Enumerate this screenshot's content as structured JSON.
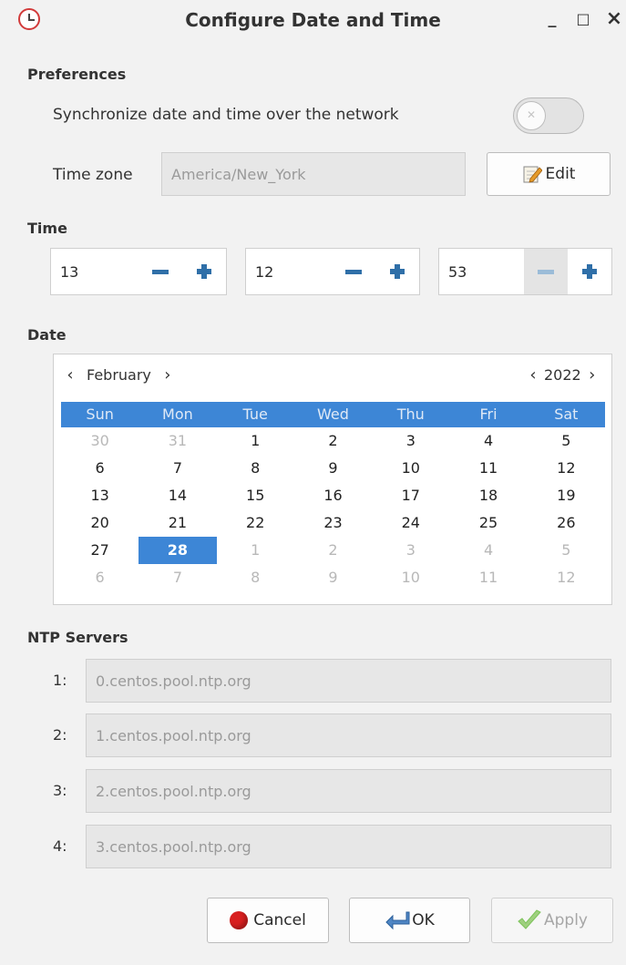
{
  "window": {
    "title": "Configure Date and Time",
    "controls": {
      "minimize": "_",
      "maximize": "□",
      "close": "×"
    }
  },
  "preferences": {
    "heading": "Preferences",
    "sync_label": "Synchronize date and time over the network",
    "sync_enabled": false,
    "timezone_label": "Time zone",
    "timezone_value": "America/New_York",
    "edit_label": "Edit"
  },
  "time": {
    "heading": "Time",
    "hours": "13",
    "minutes": "12",
    "seconds": "53"
  },
  "date": {
    "heading": "Date",
    "month": "February",
    "year": "2022",
    "prev_symbol": "‹",
    "next_symbol": "›",
    "weekdays": [
      "Sun",
      "Mon",
      "Tue",
      "Wed",
      "Thu",
      "Fri",
      "Sat"
    ],
    "days": [
      [
        "30",
        "31",
        "1",
        "2",
        "3",
        "4",
        "5"
      ],
      [
        "6",
        "7",
        "8",
        "9",
        "10",
        "11",
        "12"
      ],
      [
        "13",
        "14",
        "15",
        "16",
        "17",
        "18",
        "19"
      ],
      [
        "20",
        "21",
        "22",
        "23",
        "24",
        "25",
        "26"
      ],
      [
        "27",
        "28",
        "1",
        "2",
        "3",
        "4",
        "5"
      ],
      [
        "6",
        "7",
        "8",
        "9",
        "10",
        "11",
        "12"
      ]
    ],
    "selected_day": "28"
  },
  "ntp": {
    "heading": "NTP Servers",
    "servers": [
      {
        "label": "1:",
        "value": "0.centos.pool.ntp.org"
      },
      {
        "label": "2:",
        "value": "1.centos.pool.ntp.org"
      },
      {
        "label": "3:",
        "value": "2.centos.pool.ntp.org"
      },
      {
        "label": "4:",
        "value": "3.centos.pool.ntp.org"
      }
    ]
  },
  "buttons": {
    "cancel": "Cancel",
    "ok": "OK",
    "apply": "Apply"
  },
  "colors": {
    "accent": "#3d86d6",
    "close_icon_red": "#d23a3a",
    "cancel_dot": "#d81f1f",
    "spinner_icon": "#2f6fa8",
    "apply_check": "#7cc35a"
  }
}
